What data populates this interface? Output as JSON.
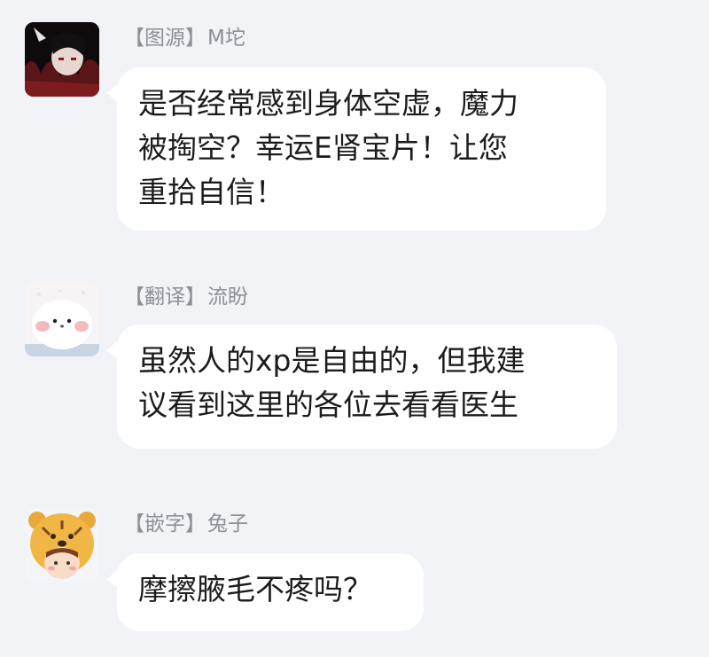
{
  "messages": [
    {
      "tag": "【图源】",
      "name": "M坨",
      "avatar": "dark-haired-anime-character-avatar",
      "text_lines": [
        "是否经常感到身体空虚，魔力",
        "被掏空？幸运E肾宝片！让您",
        "重拾自信！"
      ]
    },
    {
      "tag": "【翻译】",
      "name": "流盼",
      "avatar": "white-blush-creature-avatar",
      "text_lines": [
        "虽然人的xp是自由的，但我建",
        "议看到这里的各位去看看医生"
      ]
    },
    {
      "tag": "【嵌字】",
      "name": "兔子",
      "avatar": "tiger-hood-chibi-avatar",
      "text_lines": [
        "摩擦腋毛不疼吗？"
      ]
    }
  ]
}
